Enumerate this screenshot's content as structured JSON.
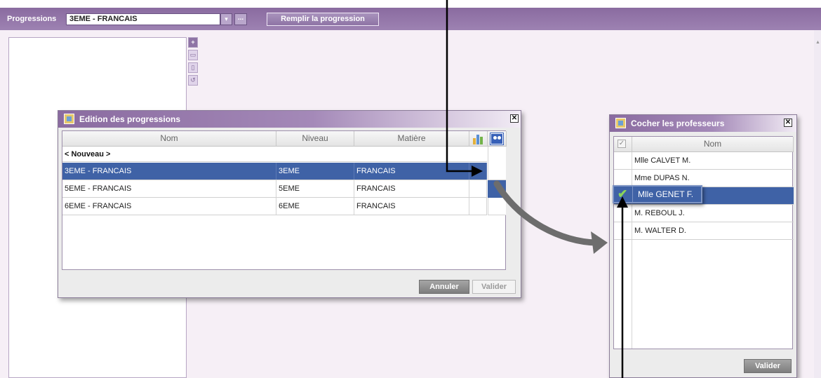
{
  "toolbar": {
    "title": "Progressions",
    "progression_value": "3EME - FRANCAIS",
    "dropdown_arrow": "▾",
    "ellipsis_label": "...",
    "fill_button_label": "Remplir la progression"
  },
  "side_tools": [
    "+",
    "▭",
    "▯",
    "↺"
  ],
  "edition_dialog": {
    "title": "Edition des progressions",
    "close_label": "✕",
    "columns": [
      "Nom",
      "Niveau",
      "Matière"
    ],
    "new_row_label": "< Nouveau >",
    "rows": [
      {
        "nom": "3EME - FRANCAIS",
        "niveau": "3EME",
        "matiere": "FRANCAIS",
        "selected": true
      },
      {
        "nom": "5EME - FRANCAIS",
        "niveau": "5EME",
        "matiere": "FRANCAIS",
        "selected": false
      },
      {
        "nom": "6EME - FRANCAIS",
        "niveau": "6EME",
        "matiere": "FRANCAIS",
        "selected": false
      }
    ],
    "cancel_label": "Annuler",
    "validate_label": "Valider",
    "icons": [
      "bar-chart-icon",
      "people-icon"
    ]
  },
  "teachers_dialog": {
    "title": "Cocher les professeurs",
    "close_label": "✕",
    "column": "Nom",
    "check_header": "✓",
    "teachers": [
      {
        "name": "Mlle CALVET M.",
        "checked": false
      },
      {
        "name": "Mme DUPAS N.",
        "checked": false
      },
      {
        "name": "Mlle GENET F.",
        "checked": true
      },
      {
        "name": "M. REBOUL J.",
        "checked": false
      },
      {
        "name": "M. WALTER D.",
        "checked": false
      }
    ],
    "validate_label": "Valider",
    "highlight": {
      "name": "Mlle GENET F.",
      "check": "✔"
    }
  },
  "colors": {
    "toolbar": "#8a6ba0",
    "selection": "#3f62a6",
    "annotation": "#000000",
    "callout_arrow": "#6d6d6d"
  }
}
